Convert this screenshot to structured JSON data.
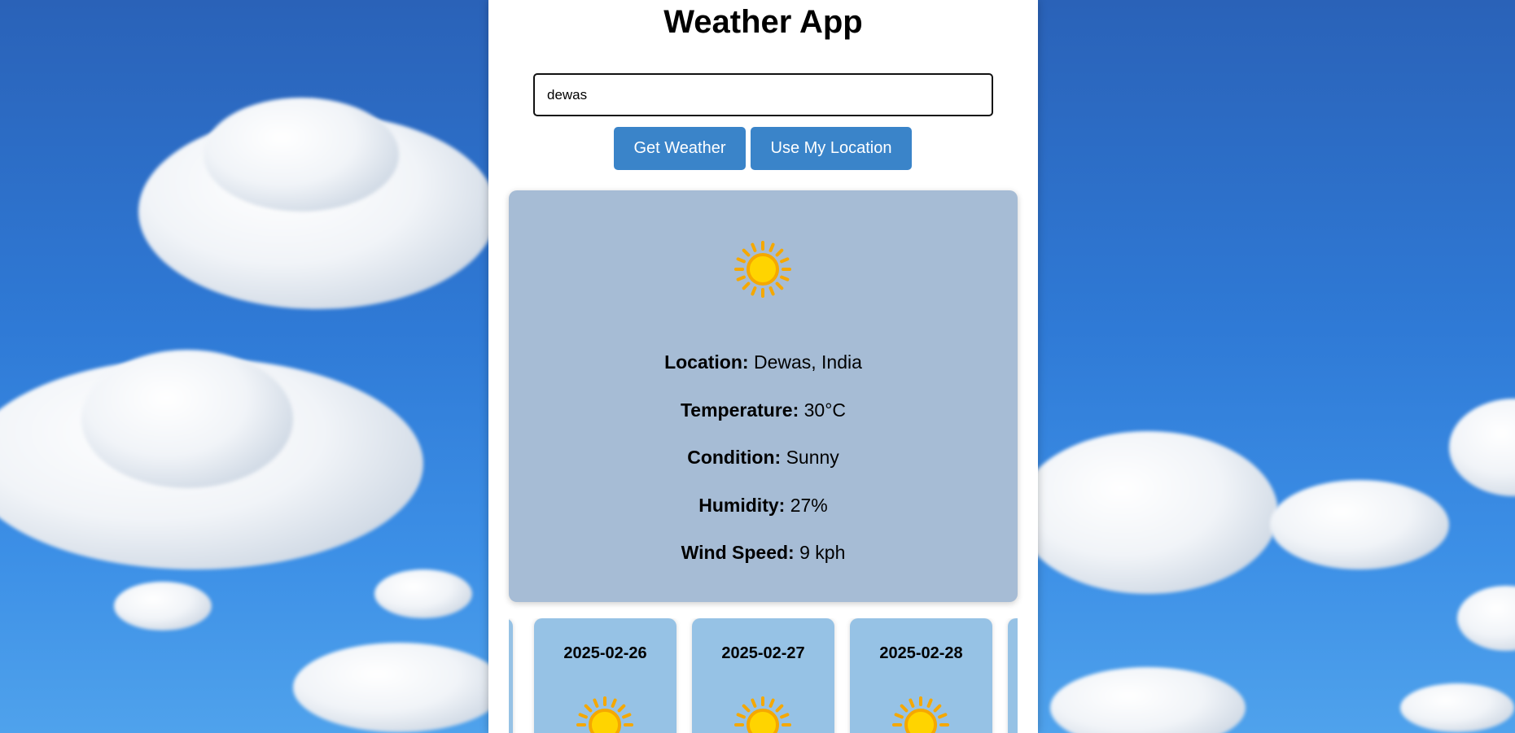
{
  "app": {
    "title": "Weather App"
  },
  "search": {
    "value": "dewas",
    "placeholder": ""
  },
  "buttons": {
    "get_weather": "Get Weather",
    "use_location": "Use My Location"
  },
  "current": {
    "icon": "sun-icon",
    "location_label": "Location:",
    "location_value": "Dewas, India",
    "temperature_label": "Temperature:",
    "temperature_value": "30°C",
    "condition_label": "Condition:",
    "condition_value": "Sunny",
    "humidity_label": "Humidity:",
    "humidity_value": "27%",
    "wind_label": "Wind Speed:",
    "wind_value": "9 kph"
  },
  "forecast": [
    {
      "date": "2025-02-26",
      "icon": "sun-icon"
    },
    {
      "date": "2025-02-27",
      "icon": "sun-icon"
    },
    {
      "date": "2025-02-28",
      "icon": "sun-icon"
    }
  ],
  "colors": {
    "accent": "#3a84c9",
    "card_bg": "#a6bcd5",
    "forecast_bg": "#96c2e5",
    "sun": "#ffd400",
    "sun_rays": "#f5a800"
  }
}
